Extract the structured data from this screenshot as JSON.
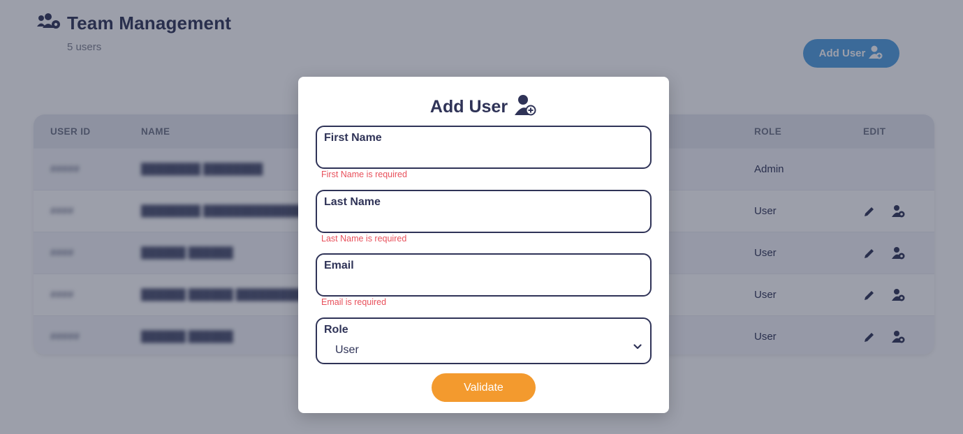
{
  "header": {
    "title": "Team Management",
    "user_count": "5 users",
    "add_user_label": "Add User"
  },
  "table": {
    "columns": {
      "user_id": "USER ID",
      "name": "NAME",
      "role": "ROLE",
      "edit": "EDIT"
    },
    "rows": [
      {
        "id": "##### ",
        "name": "████████ ████████",
        "role": "Admin",
        "editable": false
      },
      {
        "id": "####",
        "name": "████████ ████████████████",
        "role": "User",
        "editable": true
      },
      {
        "id": "####",
        "name": "██████ ██████",
        "role": "User",
        "editable": true
      },
      {
        "id": "####",
        "name": "██████ ██████ ████████████",
        "role": "User",
        "editable": true
      },
      {
        "id": "#####",
        "name": "██████ ██████",
        "role": "User",
        "editable": true
      }
    ]
  },
  "modal": {
    "title": "Add User",
    "first_name": {
      "label": "First Name",
      "value": "",
      "error": "First Name is required"
    },
    "last_name": {
      "label": "Last Name",
      "value": "",
      "error": "Last Name is required"
    },
    "email": {
      "label": "Email",
      "value": "",
      "error": "Email is required"
    },
    "role": {
      "label": "Role",
      "selected": "User"
    },
    "validate_label": "Validate"
  },
  "colors": {
    "primary_text": "#2f3357",
    "accent_blue": "#4f9fe0",
    "validate_orange": "#f39a2e",
    "error_red": "#e8505b"
  },
  "icons": {
    "title_icon": "users-cog-icon",
    "add_user_icon": "user-plus-icon",
    "edit_icon": "pencil-icon",
    "role_icon": "user-cog-icon",
    "select_icon": "chevron-down-icon"
  }
}
